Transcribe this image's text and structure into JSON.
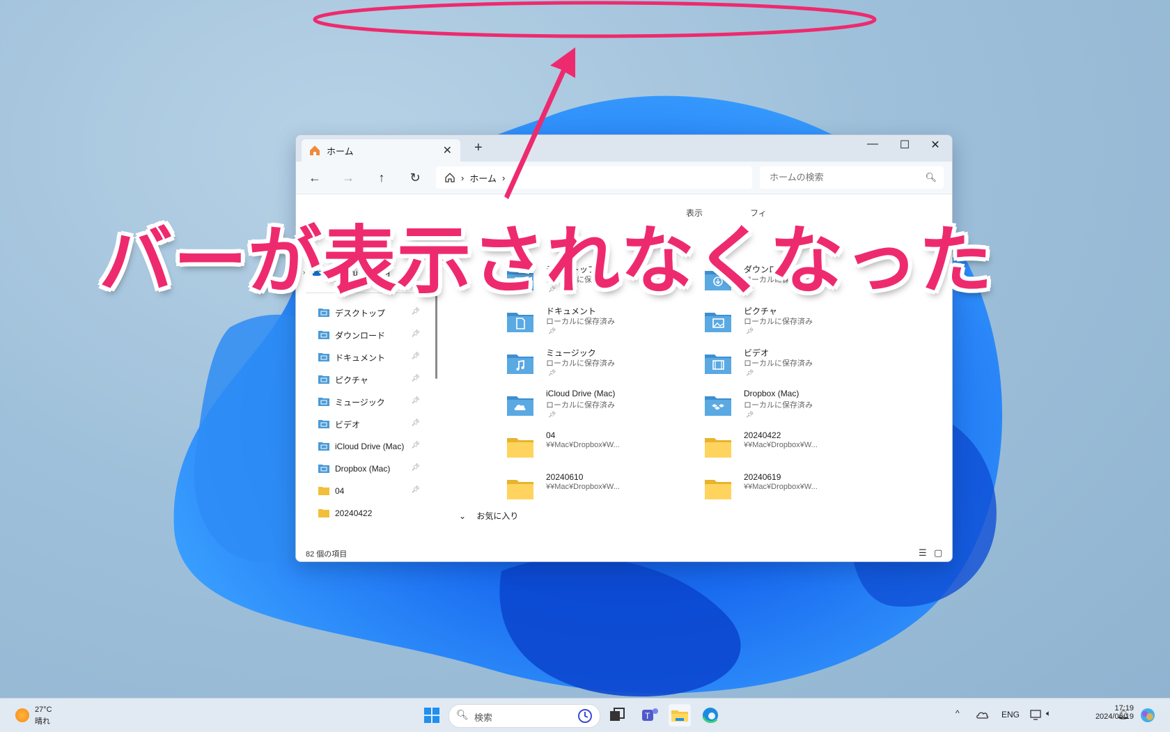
{
  "window": {
    "tab_title": "ホーム",
    "new_tab": "+",
    "close_tab": "✕",
    "minimize": "—",
    "maximize": "☐",
    "close": "✕"
  },
  "address": {
    "back": "←",
    "forward": "→",
    "up": "↑",
    "refresh": "↻",
    "breadcrumb": "ホーム",
    "sep": "›",
    "search_placeholder": "ホームの検索"
  },
  "toolbar": {
    "view_label": "表示",
    "filter_label": "フィ"
  },
  "nav_pane": {
    "onedrive": "Shigeru - 個人用",
    "items": [
      {
        "label": "デスクトップ",
        "icon": "desktop-icon"
      },
      {
        "label": "ダウンロード",
        "icon": "download-icon"
      },
      {
        "label": "ドキュメント",
        "icon": "document-icon"
      },
      {
        "label": "ピクチャ",
        "icon": "picture-icon"
      },
      {
        "label": "ミュージック",
        "icon": "music-icon"
      },
      {
        "label": "ビデオ",
        "icon": "video-icon"
      },
      {
        "label": "iCloud Drive (Mac)",
        "icon": "cloud-icon"
      },
      {
        "label": "Dropbox (Mac)",
        "icon": "dropbox-icon"
      },
      {
        "label": "04",
        "icon": "folder-icon"
      },
      {
        "label": "20240422",
        "icon": "folder-icon"
      }
    ]
  },
  "quick_access": [
    {
      "name": "デスクトップ",
      "sub": "ローカルに保存済み",
      "icon": "desktop-icon"
    },
    {
      "name": "ダウンロード",
      "sub": "ローカルに保存済み",
      "icon": "download-icon"
    },
    {
      "name": "ドキュメント",
      "sub": "ローカルに保存済み",
      "icon": "document-icon"
    },
    {
      "name": "ピクチャ",
      "sub": "ローカルに保存済み",
      "icon": "picture-icon"
    },
    {
      "name": "ミュージック",
      "sub": "ローカルに保存済み",
      "icon": "music-icon"
    },
    {
      "name": "ビデオ",
      "sub": "ローカルに保存済み",
      "icon": "video-icon"
    },
    {
      "name": "iCloud Drive (Mac)",
      "sub": "ローカルに保存済み",
      "icon": "cloud-icon"
    },
    {
      "name": "Dropbox (Mac)",
      "sub": "ローカルに保存済み",
      "icon": "dropbox-icon"
    },
    {
      "name": "04",
      "sub": "¥¥Mac¥Dropbox¥W...",
      "icon": "folder-icon"
    },
    {
      "name": "20240422",
      "sub": "¥¥Mac¥Dropbox¥W...",
      "icon": "folder-icon"
    },
    {
      "name": "20240610",
      "sub": "¥¥Mac¥Dropbox¥W...",
      "icon": "folder-icon"
    },
    {
      "name": "20240619",
      "sub": "¥¥Mac¥Dropbox¥W...",
      "icon": "folder-icon"
    }
  ],
  "favorites_header": "お気に入り",
  "status": {
    "count": "82 個の項目"
  },
  "overlay": {
    "text": "バーが表示されなくなった",
    "color": "#ee2a6e"
  },
  "taskbar": {
    "temp": "27°C",
    "weather": "晴れ",
    "search": "検索",
    "lang": "ENG",
    "time": "17:19",
    "date": "2024/06/19"
  }
}
